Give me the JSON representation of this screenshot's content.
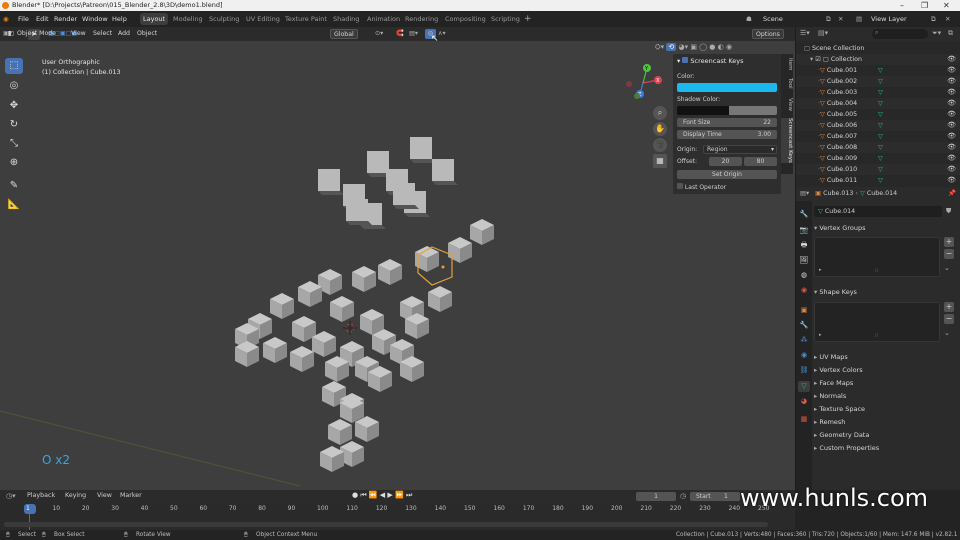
{
  "window": {
    "title": "Blender* [D:\\Projects\\Patreon\\015_Blender_2.8\\3D\\demo1.blend]",
    "min": "–",
    "max": "❐",
    "close": "✕"
  },
  "menu": [
    "File",
    "Edit",
    "Render",
    "Window",
    "Help"
  ],
  "workspaces": [
    "Layout",
    "Modeling",
    "Sculpting",
    "UV Editing",
    "Texture Paint",
    "Shading",
    "Animation",
    "Rendering",
    "Compositing",
    "Scripting"
  ],
  "active_workspace": "Layout",
  "scene": {
    "name": "Scene",
    "view_layer": "View Layer"
  },
  "viewport_header": {
    "mode": "Object Mode",
    "menus": [
      "View",
      "Select",
      "Add",
      "Object"
    ],
    "orientation": "Global",
    "options": "Options"
  },
  "viewport": {
    "view_name": "User Orthographic",
    "collection_info": "(1) Collection | Cube.013",
    "screencast_text": "O x2"
  },
  "screencast_panel": {
    "title": "Screencast Keys",
    "color_label": "Color:",
    "color": "#1bb8ef",
    "shadow_label": "Shadow Color:",
    "font_size_label": "Font Size",
    "font_size": "22",
    "display_time_label": "Display Time",
    "display_time": "3.00",
    "origin_label": "Origin:",
    "origin_value": "Region",
    "offset_label": "Offset:",
    "offset_x": "20",
    "offset_y": "80",
    "set_origin": "Set Origin",
    "last_operator": "Last Operator"
  },
  "side_tabs": [
    "Item",
    "Tool",
    "View",
    "Screencast Keys"
  ],
  "outliner": {
    "scene_collection": "Scene Collection",
    "collection": "Collection",
    "items": [
      "Cube.001",
      "Cube.002",
      "Cube.003",
      "Cube.004",
      "Cube.005",
      "Cube.006",
      "Cube.007",
      "Cube.008",
      "Cube.009",
      "Cube.010",
      "Cube.011"
    ]
  },
  "properties": {
    "breadcrumb_object": "Cube.013",
    "breadcrumb_mesh": "Cube.014",
    "mesh_name": "Cube.014",
    "sections": [
      "Vertex Groups",
      "Shape Keys",
      "UV Maps",
      "Vertex Colors",
      "Face Maps",
      "Normals",
      "Texture Space",
      "Remesh",
      "Geometry Data",
      "Custom Properties"
    ]
  },
  "timeline": {
    "menus": [
      "Playback",
      "Keying",
      "View",
      "Marker"
    ],
    "current_frame": "1",
    "start_label": "Start",
    "start": "1",
    "ticks": [
      "1",
      "10",
      "20",
      "30",
      "40",
      "50",
      "60",
      "70",
      "80",
      "90",
      "100",
      "110",
      "120",
      "130",
      "140",
      "150",
      "160",
      "170",
      "180",
      "190",
      "200",
      "210",
      "220",
      "230",
      "240",
      "250"
    ]
  },
  "statusbar": {
    "select": "Select",
    "box_select": "Box Select",
    "rotate_view": "Rotate View",
    "context_menu": "Object Context Menu",
    "stats": "Collection | Cube.013 | Verts:480 | Faces:360 | Tris:720 | Objects:1/60 | Mem: 147.6 MiB | v2.82.1"
  },
  "watermark": "www.hunls.com"
}
